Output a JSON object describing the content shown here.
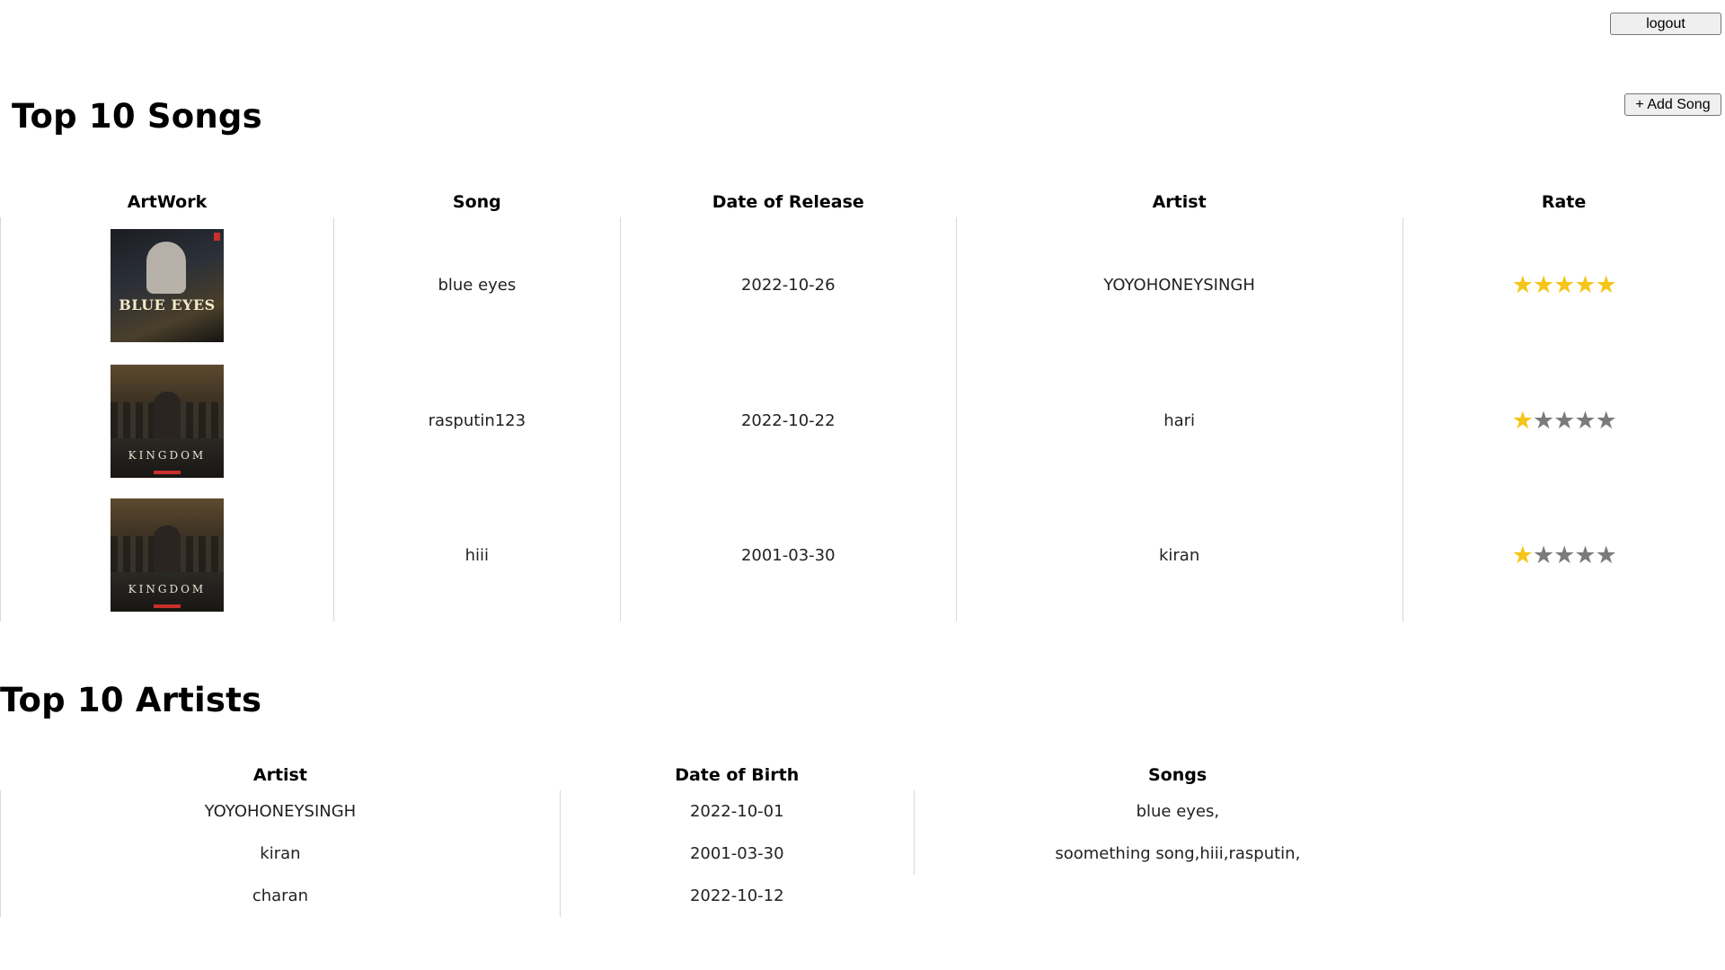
{
  "header": {
    "logout_label": "logout"
  },
  "songs_section": {
    "title": "Top 10 Songs",
    "add_label": "+ Add Song",
    "columns": [
      "ArtWork",
      "Song",
      "Date of Release",
      "Artist",
      "Rate"
    ],
    "rows": [
      {
        "artwork_title": "BLUE EYES",
        "song": "blue eyes",
        "date": "2022-10-26",
        "artist": "YOYOHONEYSINGH",
        "rating": 5
      },
      {
        "artwork_title": "KINGDOM",
        "song": "rasputin123",
        "date": "2022-10-22",
        "artist": "hari",
        "rating": 1
      },
      {
        "artwork_title": "KINGDOM",
        "song": "hiii",
        "date": "2001-03-30",
        "artist": "kiran",
        "rating": 1
      }
    ],
    "rating_max": 5,
    "star_color_on": "#f5c518",
    "star_color_off": "#7b7b7b"
  },
  "artists_section": {
    "title": "Top 10 Artists",
    "columns": [
      "Artist",
      "Date of Birth",
      "Songs"
    ],
    "rows": [
      {
        "artist": "YOYOHONEYSINGH",
        "dob": "2022-10-01",
        "songs": "blue eyes,"
      },
      {
        "artist": "kiran",
        "dob": "2001-03-30",
        "songs": "soomething song,hiii,rasputin,"
      },
      {
        "artist": "charan",
        "dob": "2022-10-12",
        "songs": ""
      }
    ]
  }
}
